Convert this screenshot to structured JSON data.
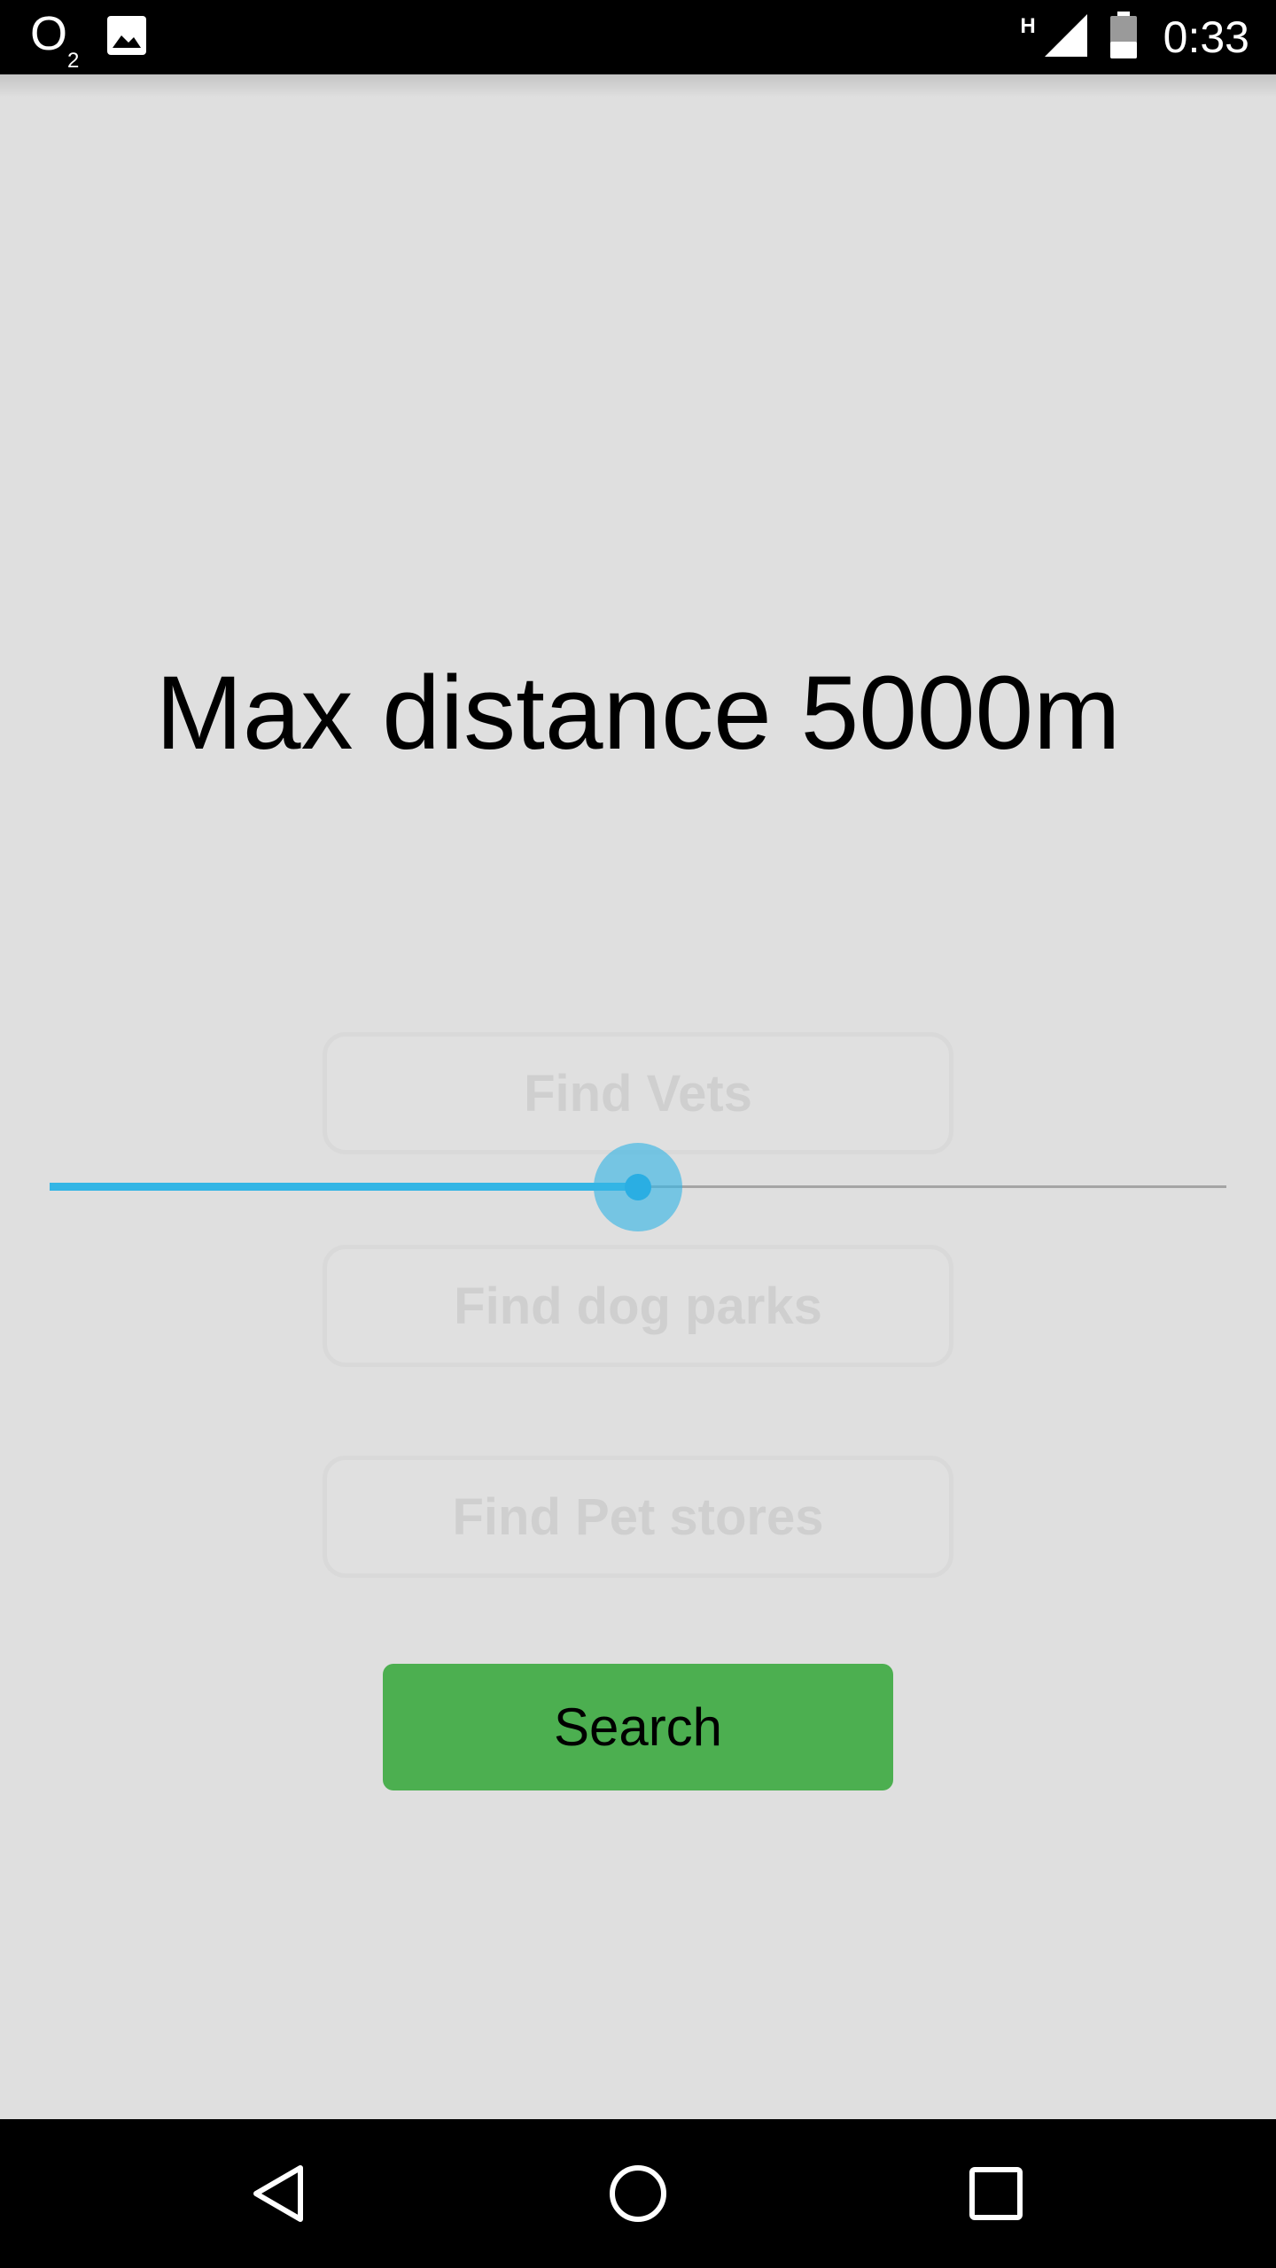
{
  "status_bar": {
    "carrier": "O",
    "carrier_sub": "2",
    "network_type": "H",
    "time": "0:33",
    "icons": [
      "gallery-icon",
      "signal-icon",
      "battery-icon"
    ]
  },
  "main": {
    "title": "Max distance 5000m",
    "slider": {
      "value_fraction": 0.5,
      "accent_color": "#33b5e5"
    },
    "buttons": {
      "vets": "Find Vets",
      "dog_parks": "Find dog parks",
      "pet_stores": "Find Pet stores"
    },
    "search": {
      "label": "Search",
      "color": "#4caf50"
    }
  },
  "nav_bar": {
    "icons": [
      "back-icon",
      "home-icon",
      "recents-icon"
    ]
  }
}
